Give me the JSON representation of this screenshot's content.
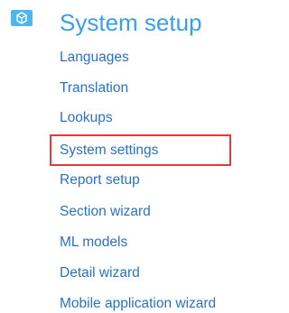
{
  "section": {
    "title": "System setup",
    "icon": "settings-cube-icon",
    "accent_color": "#3a9ee8",
    "link_color": "#2a73c2",
    "highlight_color": "#e23b3b"
  },
  "menu": {
    "items": [
      {
        "label": "Languages"
      },
      {
        "label": "Translation"
      },
      {
        "label": "Lookups"
      },
      {
        "label": "System settings",
        "highlighted": true
      },
      {
        "label": "Report setup"
      },
      {
        "label": "Section wizard"
      },
      {
        "label": "ML models"
      },
      {
        "label": "Detail wizard"
      },
      {
        "label": "Mobile application wizard"
      }
    ]
  }
}
